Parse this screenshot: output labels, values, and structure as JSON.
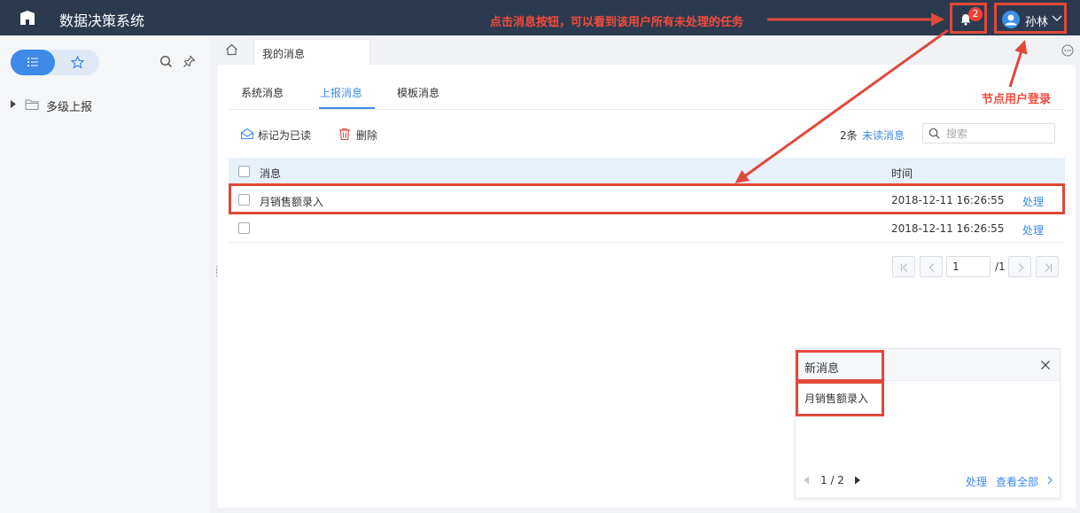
{
  "header": {
    "title": "数据决策系统",
    "annotation": "点击消息按钮，可以看到该用户所有未处理的任务",
    "notification_count": "2",
    "user_name": "孙林"
  },
  "sidebar": {
    "tree": [
      {
        "label": "多级上报"
      }
    ]
  },
  "tabs": {
    "page_tab": "我的消息"
  },
  "main": {
    "sub_tabs": [
      "系统消息",
      "上报消息",
      "模板消息"
    ],
    "active_sub_tab": "上报消息",
    "annotation_login": "节点用户登录",
    "toolbar": {
      "mark_read": "标记为已读",
      "delete": "删除",
      "unread_count": "2条",
      "unread_link": "未读消息",
      "search_placeholder": "搜索"
    },
    "table": {
      "headers": {
        "message": "消息",
        "time": "时间"
      },
      "rows": [
        {
          "message": "月销售额录入",
          "time": "2018-12-11 16:26:55",
          "action": "处理"
        },
        {
          "message": "",
          "time": "2018-12-11 16:26:55",
          "action": "处理"
        }
      ]
    },
    "pagination": {
      "current": "1",
      "total": "/1"
    }
  },
  "popup": {
    "title": "新消息",
    "item": "月销售额录入",
    "page": "1 / 2",
    "handle": "处理",
    "view_all": "查看全部"
  },
  "colors": {
    "topbar": "#2c3a4f",
    "accent": "#3d8ae8",
    "annotation": "#f34b3c"
  }
}
